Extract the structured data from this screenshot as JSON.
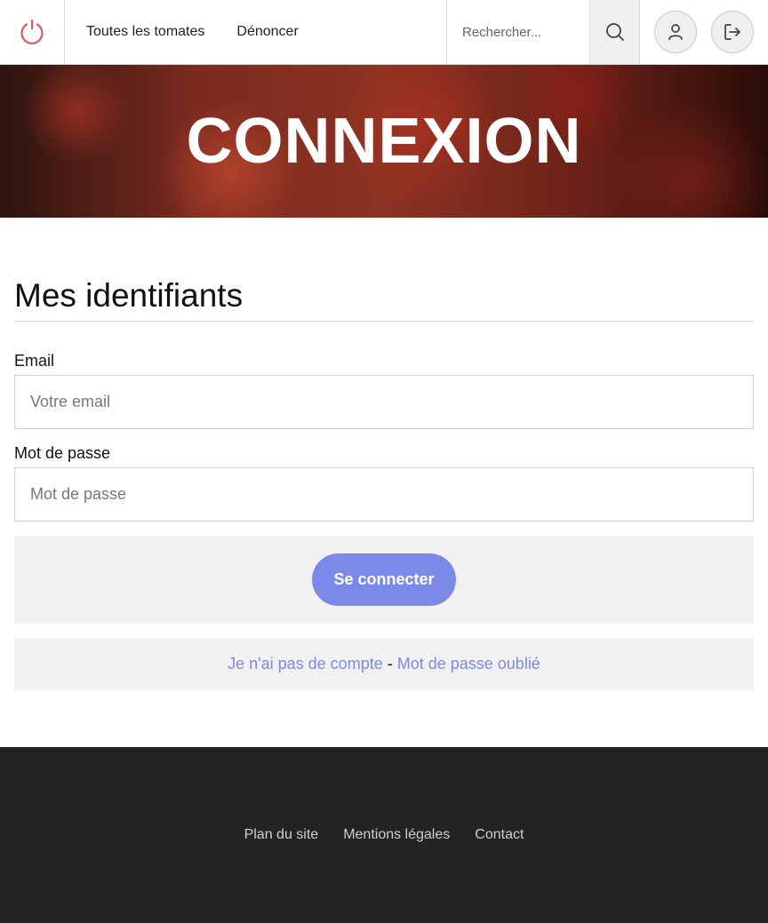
{
  "header": {
    "nav": [
      {
        "label": "Toutes les tomates"
      },
      {
        "label": "Dénoncer"
      }
    ],
    "search": {
      "placeholder": "Rechercher..."
    },
    "icons": {
      "logo": "power-icon",
      "search": "search-icon",
      "user": "user-icon",
      "logout": "logout-icon"
    },
    "accent": "#e05555"
  },
  "hero": {
    "title": "CONNEXION"
  },
  "form": {
    "section_title": "Mes identifiants",
    "email_label": "Email",
    "email_placeholder": "Votre email",
    "email_value": "",
    "password_label": "Mot de passe",
    "password_placeholder": "Mot de passe",
    "password_value": "",
    "submit_label": "Se connecter",
    "no_account_link": "Je n'ai pas de compte",
    "separator": "-",
    "forgot_link": "Mot de passe oublié",
    "accent": "#7b8ae8"
  },
  "footer": {
    "links": [
      {
        "label": "Plan du site"
      },
      {
        "label": "Mentions légales"
      },
      {
        "label": "Contact"
      }
    ]
  }
}
